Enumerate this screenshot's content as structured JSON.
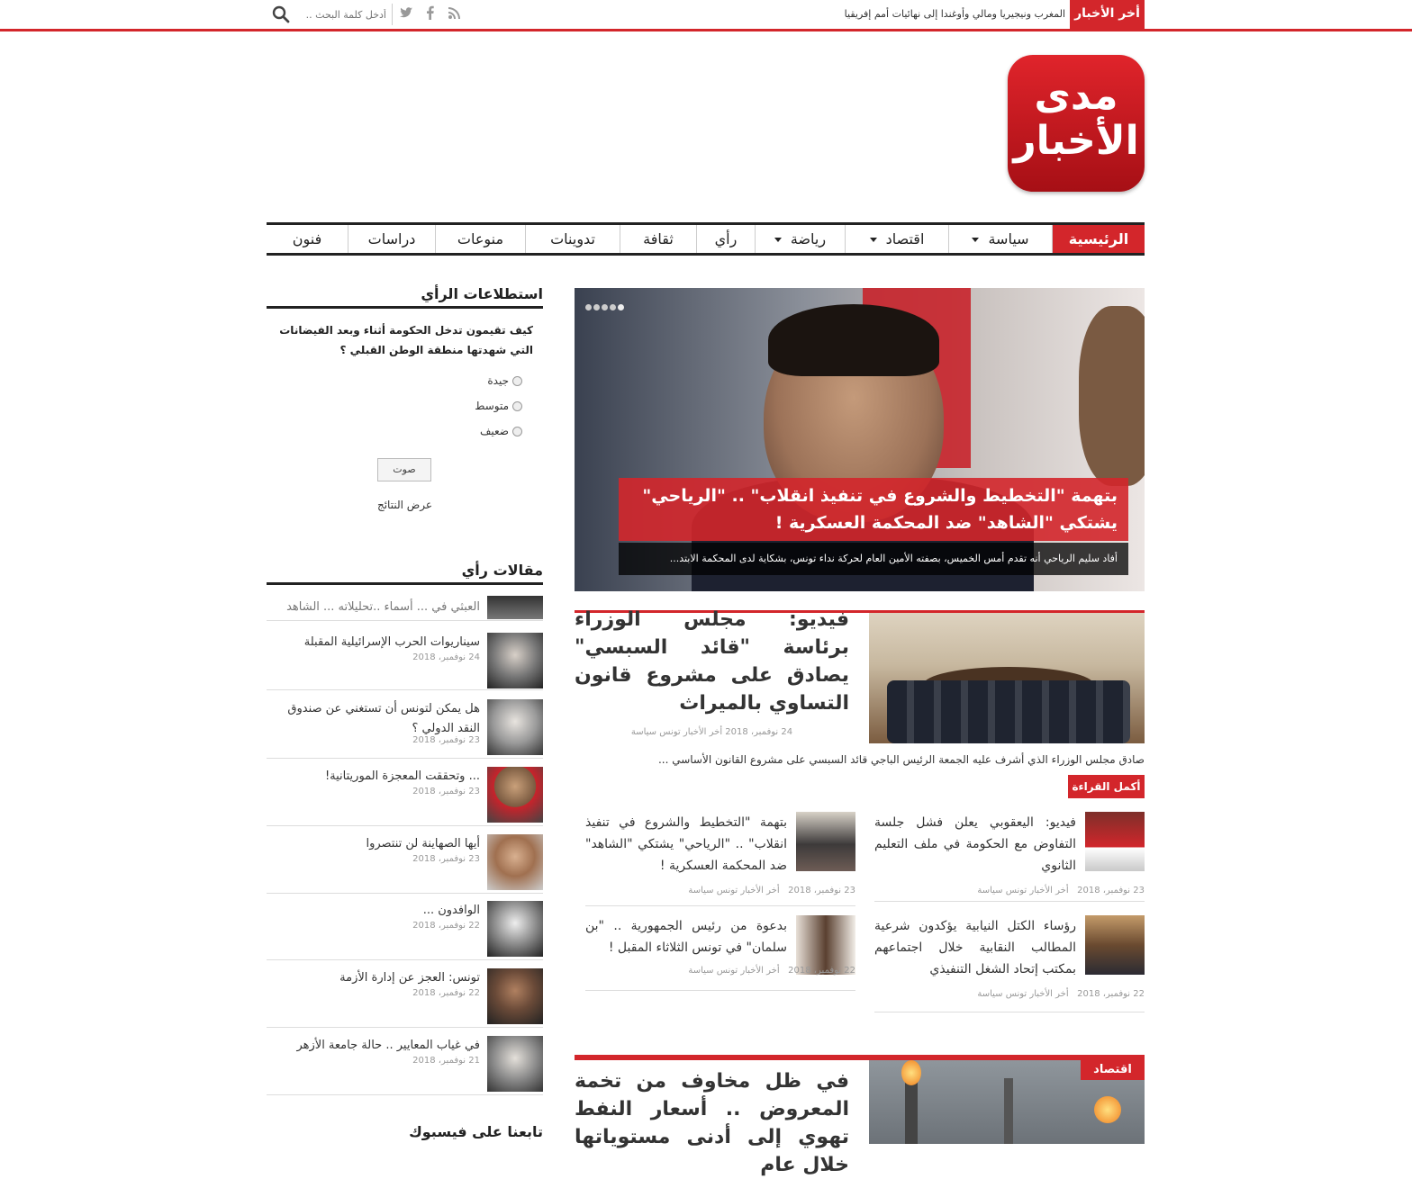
{
  "topbar": {
    "breaking_label": "أخر الأخبار",
    "breaking_text": "المغرب ونيجيريا ومالي وأوغندا إلى نهائيات أمم إفريقيا",
    "search_placeholder": "أدخل كلمة البحث ..",
    "social_icons": [
      "rss-icon",
      "facebook-icon",
      "twitter-icon"
    ]
  },
  "logo": {
    "line1": "مدى",
    "line2": "الأخبار"
  },
  "nav": [
    {
      "label": "الرئيسية",
      "active": true
    },
    {
      "label": "سياسة",
      "dropdown": true
    },
    {
      "label": "اقتصاد",
      "dropdown": true
    },
    {
      "label": "رياضة",
      "dropdown": true
    },
    {
      "label": "رأي"
    },
    {
      "label": "ثقافة"
    },
    {
      "label": "تدوينات"
    },
    {
      "label": "منوعات"
    },
    {
      "label": "دراسات"
    },
    {
      "label": "فنون"
    }
  ],
  "hero": {
    "title": "بتهمة \"التخطيط والشروع في تنفيذ انقلاب\" .. \"الرياحي\" يشتكي \"الشاهد\" ضد المحكمة العسكرية !",
    "description": "أفاد سليم الرياحي أنه تقدم أمس الخميس، بصفته الأمين العام لحركة نداء تونس، بشكاية لدى المحكمة الابتد..."
  },
  "feature": {
    "title": "فيديو: مجلس الوزراء برئاسة \"قائد السبسي\" يصادق على مشروع قانون التساوي بالميراث",
    "meta": "24 نوفمبر، 2018  أخر الأخبار تونس سياسة",
    "excerpt": "صادق مجلس الوزراء الذي أشرف عليه الجمعة الرئيس الباجي قائد السبسي على مشروع القانون الأساسي ...",
    "read_more": "أكمل القراءة »"
  },
  "cards": [
    {
      "title": "فيديو: اليعقوبي يعلن فشل جلسة التفاوض مع الحكومة في ملف التعليم الثانوي",
      "date": "23 نوفمبر، 2018",
      "cats": "أخر الأخبار تونس سياسة"
    },
    {
      "title": "بتهمة \"التخطيط والشروع في تنفيذ انقلاب\" .. \"الرياحي\" يشتكي \"الشاهد\" ضد المحكمة العسكرية !",
      "date": "23 نوفمبر، 2018",
      "cats": "أخر الأخبار تونس سياسة"
    },
    {
      "title": "رؤساء الكتل النيابية يؤكدون شرعية المطالب النقابية خلال اجتماعهم بمكتب إتحاد الشغل التنفيذي",
      "date": "22 نوفمبر، 2018",
      "cats": "أخر الأخبار تونس سياسة"
    },
    {
      "title": "بدعوة من رئيس الجمهورية .. \"بن سلمان\" في تونس الثلاثاء المقبل !",
      "date": "22 نوفمبر، 2018",
      "cats": "أخر الأخبار تونس سياسة"
    }
  ],
  "section2": {
    "tag": "اقتصاد",
    "title": "في ظل مخاوف من تخمة المعروض .. أسعار النفط تهوي إلى أدنى مستوياتها خلال عام"
  },
  "sidebar": {
    "poll_heading": "استطلاعات الرأي",
    "poll_question": "كيف تقيمون تدخل الحكومة أثناء وبعد الفيضانات التي شهدتها منطقة الوطن القبلي ؟",
    "poll_options": [
      "جيدة",
      "متوسط",
      "ضعيف"
    ],
    "vote_label": "صوت",
    "results_label": "عرض النتائج",
    "articles_heading": "مقالات رأي",
    "articles": [
      {
        "title": "العبثي في ... أسماء ..تحليلاته ... الشاهد بحقا",
        "date": ""
      },
      {
        "title": "سيناريوات الحرب الإسرائيلية المقبلة",
        "date": "24 نوفمبر، 2018"
      },
      {
        "title": "هل يمكن لتونس أن تستغني عن صندوق النقد الدولي ؟",
        "date": "23 نوفمبر، 2018"
      },
      {
        "title": "... وتحققت المعجزة الموريتانية!",
        "date": "23 نوفمبر، 2018"
      },
      {
        "title": "أيها الصهاينة لن تنتصروا",
        "date": "23 نوفمبر، 2018"
      },
      {
        "title": "الوافدون ...",
        "date": "22 نوفمبر، 2018"
      },
      {
        "title": "تونس: العجز عن إدارة الأزمة",
        "date": "22 نوفمبر، 2018"
      },
      {
        "title": "في غياب المعايير .. حالة جامعة الأزهر",
        "date": "21 نوفمبر، 2018"
      }
    ],
    "facebook_heading": "تابعنا على فيسبوك"
  },
  "colors": {
    "accent": "#d3262b",
    "text": "#222222",
    "meta": "#999999"
  }
}
